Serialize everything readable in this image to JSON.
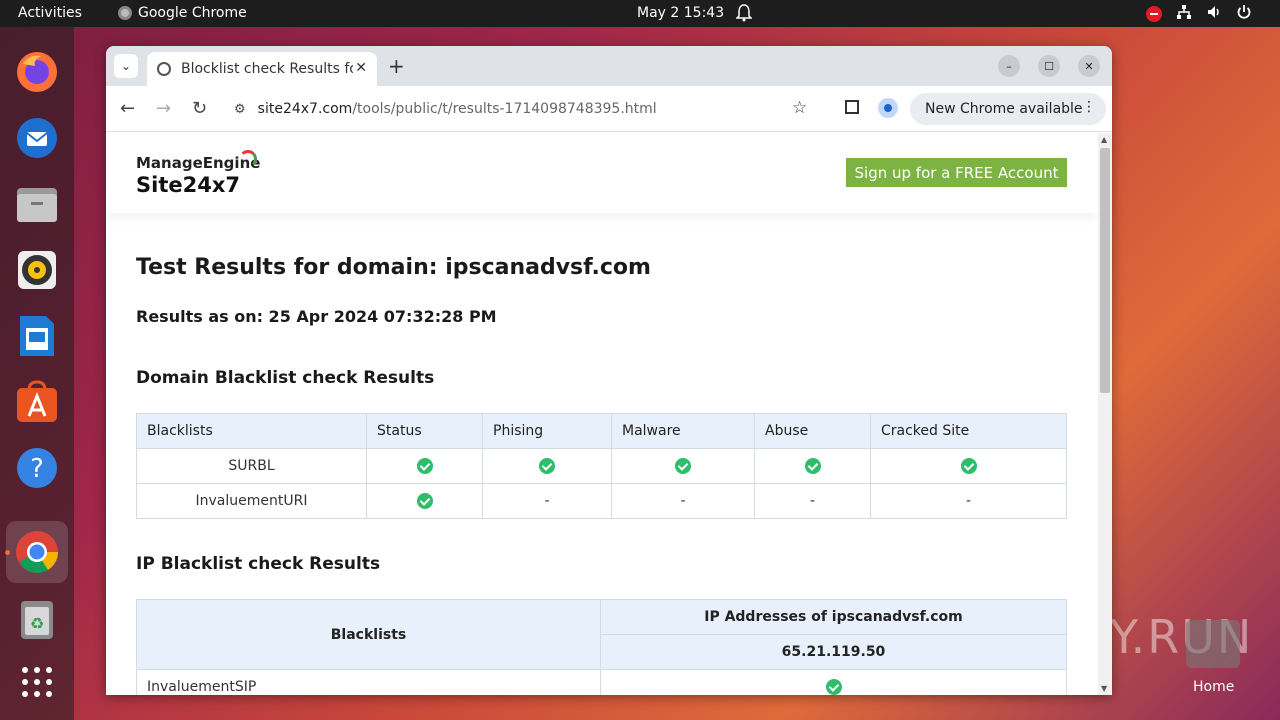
{
  "topbar": {
    "activities": "Activities",
    "app_name": "Google Chrome",
    "clock": "May 2  15:43"
  },
  "dock": {
    "items": [
      "firefox",
      "thunderbird",
      "files",
      "rhythmbox",
      "writer",
      "software",
      "help",
      "chrome",
      "trash",
      "apps"
    ]
  },
  "browser": {
    "tab_title": "Blocklist check Results for ipscanadvsf.com",
    "url_host": "site24x7.com",
    "url_path": "/tools/public/t/results-1714098748395.html",
    "update_label": "New Chrome available"
  },
  "site": {
    "brand_top": "ManageEngine",
    "brand_bottom": "Site24x7",
    "signup": "Sign up for a FREE Account",
    "title": "Test Results for domain: ipscanadvsf.com",
    "as_of": "Results as on: 25 Apr 2024 07:32:28 PM",
    "domain_section": "Domain Blacklist check Results",
    "ip_section": "IP Blacklist check Results"
  },
  "domain_table": {
    "headers": [
      "Blacklists",
      "Status",
      "Phising",
      "Malware",
      "Abuse",
      "Cracked Site"
    ],
    "rows": [
      {
        "name": "SURBL",
        "cells": [
          "check",
          "check",
          "check",
          "check",
          "check"
        ]
      },
      {
        "name": "InvaluementURI",
        "cells": [
          "check",
          "-",
          "-",
          "-",
          "-"
        ]
      }
    ]
  },
  "ip_table": {
    "col1": "Blacklists",
    "col2": "IP Addresses of ipscanadvsf.com",
    "ip": "65.21.119.50",
    "rows": [
      {
        "name": "InvaluementSIP",
        "cell": "check"
      }
    ]
  },
  "watermark": "ANY.RUN",
  "home_label": "Home"
}
